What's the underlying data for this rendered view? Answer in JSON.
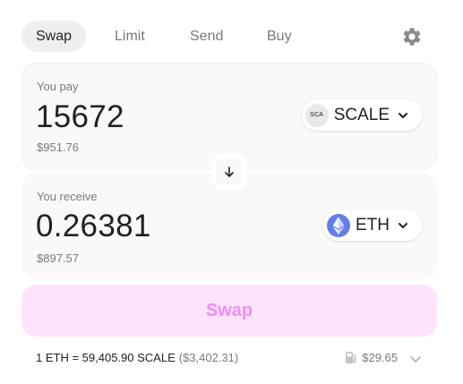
{
  "tabs": [
    {
      "label": "Swap"
    },
    {
      "label": "Limit"
    },
    {
      "label": "Send"
    },
    {
      "label": "Buy"
    }
  ],
  "icons": {
    "settings": "gear-icon",
    "flip": "arrow-down-icon",
    "token_dropdown": "chevron-down-icon",
    "gas": "gas-pump-icon",
    "details": "chevron-down-icon"
  },
  "pay": {
    "label": "You pay",
    "amount": "15672",
    "usd_value": "$951.76",
    "token": {
      "symbol": "SCALE",
      "logo_text": "SCA"
    }
  },
  "receive": {
    "label": "You receive",
    "amount": "0.26381",
    "usd_value": "$897.57",
    "token": {
      "symbol": "ETH"
    }
  },
  "swap_button": {
    "label": "Swap"
  },
  "rate": {
    "text": "1 ETH = 59,405.90 SCALE",
    "usd": "($3,402.31)"
  },
  "gas": {
    "fee": "$29.65"
  },
  "colors": {
    "accent_text": "#f38cf0",
    "accent_bg": "#fde4fc",
    "eth_brand": "#627eea",
    "panel_bg": "#f9f9f9",
    "muted_text": "#7a7a7a"
  }
}
